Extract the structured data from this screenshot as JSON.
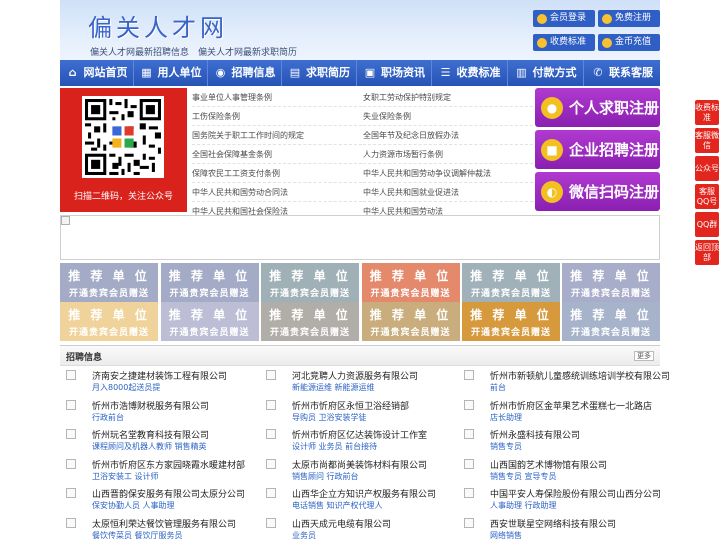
{
  "header": {
    "title": "偏关人才网",
    "subtitle": "偏关人才网最新招聘信息　偏关人才网最新求职简历",
    "buttons": [
      {
        "label": "会员登录"
      },
      {
        "label": "免费注册"
      },
      {
        "label": "收费标准"
      },
      {
        "label": "金币充值"
      }
    ]
  },
  "nav": {
    "items": [
      {
        "label": "网站首页",
        "icon": "home-icon"
      },
      {
        "label": "用人单位",
        "icon": "building-icon"
      },
      {
        "label": "招聘信息",
        "icon": "megaphone-icon"
      },
      {
        "label": "求职简历",
        "icon": "resume-icon"
      },
      {
        "label": "职场资讯",
        "icon": "news-icon"
      },
      {
        "label": "收费标准",
        "icon": "money-icon"
      },
      {
        "label": "付款方式",
        "icon": "wallet-icon"
      },
      {
        "label": "联系客服",
        "icon": "phone-icon"
      }
    ]
  },
  "qr": {
    "caption": "扫描二维码，关注公众号"
  },
  "links_left": [
    "事业单位人事管理条例",
    "工伤保险条例",
    "国务院关于职工工作时间的规定",
    "全国社会保障基金条例",
    "保障农民工工资支付条例",
    "中华人民共和国劳动合同法",
    "中华人民共和国社会保险法"
  ],
  "links_right": [
    "女职工劳动保护特别规定",
    "失业保险条例",
    "全国年节及纪念日放假办法",
    "人力资源市场暂行条例",
    "中华人民共和国劳动争议调解仲裁法",
    "中华人民共和国就业促进法",
    "中华人民共和国劳动法"
  ],
  "cta": [
    {
      "label": "个人求职注册",
      "icon": "person-icon"
    },
    {
      "label": "企业招聘注册",
      "icon": "company-icon"
    },
    {
      "label": "微信扫码注册",
      "icon": "wechat-icon"
    }
  ],
  "ads": {
    "line1": "推 荐 单 位",
    "line2": "开通贵宾会员赠送",
    "colors": [
      "#a3abc6",
      "#a3abc6",
      "#9fb0b6",
      "#e5896c",
      "#a0b1b9",
      "#a8adc9",
      "#f0d39a",
      "#bdbdd6",
      "#b1ada8",
      "#c9ad7c",
      "#d69a3d",
      "#a6b3cb"
    ]
  },
  "jobs_section": {
    "title": "招聘信息",
    "more": "更多"
  },
  "jobs": [
    {
      "company": "济南安之捷建材装饰工程有限公司",
      "positions": "月入8000起送员提"
    },
    {
      "company": "河北竞聘人力资源服务有限公司",
      "positions": "新能源运维 新能源运维"
    },
    {
      "company": "忻州市新顿航儿童感统训练培训学校有限公司",
      "positions": "前台"
    },
    {
      "company": "忻州市浩博财税服务有限公司",
      "positions": "行政前台"
    },
    {
      "company": "忻州市忻府区永恒卫浴经销部",
      "positions": "导购员 卫浴安装学徒"
    },
    {
      "company": "忻州市忻府区金苹果艺术蛋糕七一北路店",
      "positions": "店长助理"
    },
    {
      "company": "忻州玩名堂教育科技有限公司",
      "positions": "课程顾问及机器人教师 销售精英"
    },
    {
      "company": "忻州市忻府区亿达装饰设计工作室",
      "positions": "设计师 业务员 前台接待"
    },
    {
      "company": "忻州永盛科技有限公司",
      "positions": "销售专员"
    },
    {
      "company": "忻州市忻府区东方家园晓霞水暖建材部",
      "positions": "卫浴安装工 设计师"
    },
    {
      "company": "太原市尚都尚美装饰材料有限公司",
      "positions": "销售顾问 行政前台"
    },
    {
      "company": "山西国韵艺术博物馆有限公司",
      "positions": "销售专员 宣导专员"
    },
    {
      "company": "山西晋韵保安服务有限公司太原分公司",
      "positions": "保安协勤人员 人事助理"
    },
    {
      "company": "山西华企立方知识产权服务有限公司",
      "positions": "电话销售 知识产权代理人"
    },
    {
      "company": "中国平安人寿保险股份有限公司山西分公司",
      "positions": "人事助理 行政助理"
    },
    {
      "company": "太原恒利荣达餐饮管理服务有限公司",
      "positions": "餐饮传菜员 餐饮厅服务员"
    },
    {
      "company": "山西天成元电缆有限公司",
      "positions": "业务员"
    },
    {
      "company": "西安世联星空网络科技有限公司",
      "positions": "网络销售"
    }
  ],
  "sidebar": [
    {
      "label": "收费标准"
    },
    {
      "label": "客服微信"
    },
    {
      "label": "公众号"
    },
    {
      "label": "客服QQ号"
    },
    {
      "label": "QQ群"
    },
    {
      "label": "返回顶部"
    }
  ]
}
